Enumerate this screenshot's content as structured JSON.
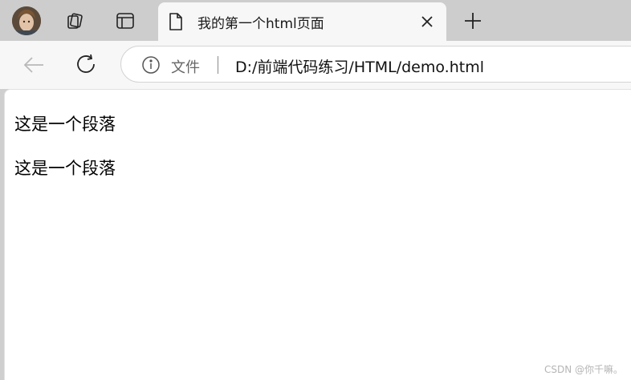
{
  "tab": {
    "title": "我的第一个html页面"
  },
  "address_bar": {
    "scheme_label": "文件",
    "url": "D:/前端代码练习/HTML/demo.html"
  },
  "page": {
    "paragraphs": [
      "这是一个段落",
      "这是一个段落"
    ]
  },
  "watermark": "CSDN @你千嘛。",
  "icons": {
    "avatar": "profile-avatar",
    "workspaces": "workspaces-icon",
    "tab_actions": "vertical-tabs-icon",
    "page": "page-icon",
    "close": "close-icon",
    "new_tab": "plus-icon",
    "back": "back-arrow-icon",
    "refresh": "refresh-icon",
    "info": "info-icon"
  }
}
